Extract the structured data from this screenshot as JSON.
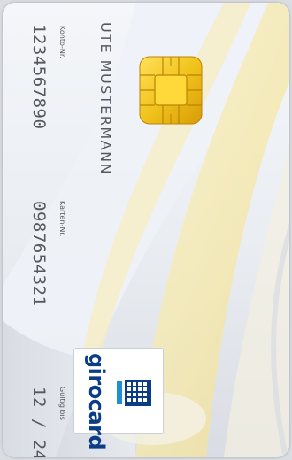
{
  "card": {
    "holder_name": "UTE MUSTERMANN",
    "account_label": "Konto-Nr.",
    "account_number": "1234567890",
    "card_label": "Karten-Nr.",
    "card_number": "0987654321",
    "valid_label": "Gültig bis",
    "valid_until": "12 / 24",
    "brand": "girocard"
  },
  "colors": {
    "text": "#55585e",
    "brand_blue": "#0b3d87",
    "chip_gold": "#f1c31c",
    "accent_yellow": "#f6e7a4"
  },
  "icons": {
    "chip": "emv-chip-icon",
    "brand": "girocard-logo-icon"
  }
}
